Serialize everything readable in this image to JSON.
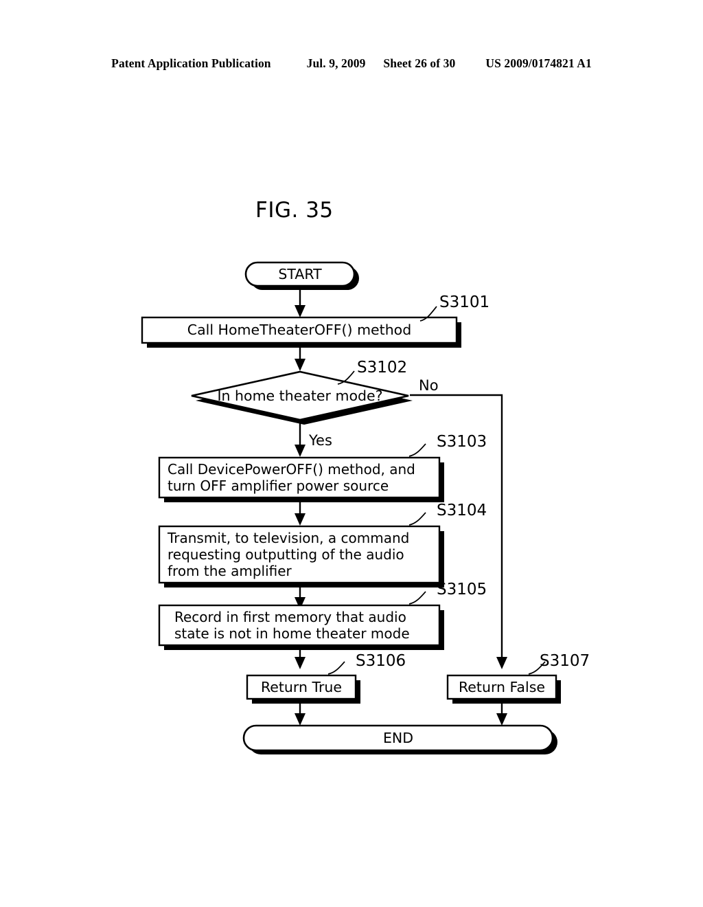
{
  "header": {
    "publication": "Patent Application Publication",
    "date": "Jul. 9, 2009",
    "sheet": "Sheet 26 of 30",
    "patent_number": "US 2009/0174821 A1"
  },
  "figure": {
    "title": "FIG. 35"
  },
  "flowchart": {
    "start_label": "START",
    "end_label": "END",
    "branch_yes": "Yes",
    "branch_no": "No",
    "nodes": [
      {
        "id": "s3101",
        "tag": "S3101",
        "type": "process",
        "lines": [
          "Call HomeTheaterOFF() method"
        ]
      },
      {
        "id": "s3102",
        "tag": "S3102",
        "type": "decision",
        "lines": [
          "In home theater mode?"
        ]
      },
      {
        "id": "s3103",
        "tag": "S3103",
        "type": "process",
        "lines": [
          "Call DevicePowerOFF() method, and",
          "turn OFF amplifier power source"
        ]
      },
      {
        "id": "s3104",
        "tag": "S3104",
        "type": "process",
        "lines": [
          "Transmit, to television, a command",
          "requesting outputting of the audio",
          "from the amplifier"
        ]
      },
      {
        "id": "s3105",
        "tag": "S3105",
        "type": "process",
        "lines": [
          "Record in first memory that audio",
          "state is not in home theater mode"
        ]
      },
      {
        "id": "s3106",
        "tag": "S3106",
        "type": "process",
        "lines": [
          "Return True"
        ]
      },
      {
        "id": "s3107",
        "tag": "S3107",
        "type": "process",
        "lines": [
          "Return False"
        ]
      }
    ]
  },
  "colors": {
    "ink": "#000000",
    "paper": "#ffffff"
  }
}
